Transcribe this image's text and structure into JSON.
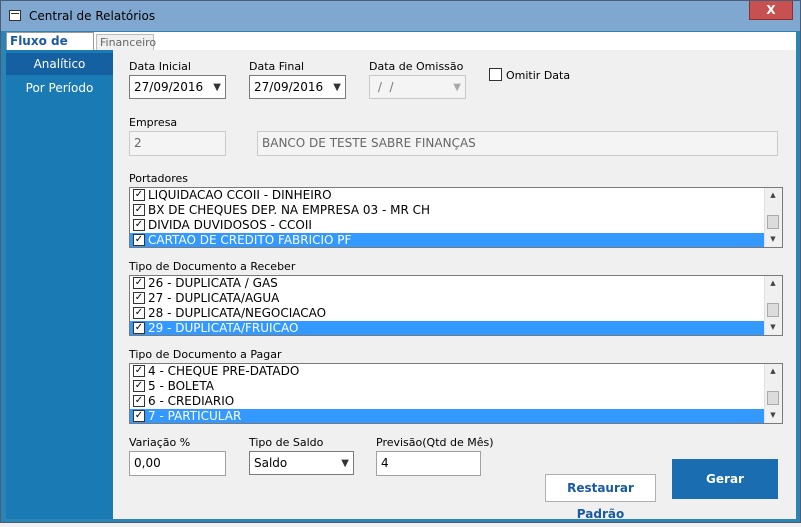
{
  "window": {
    "title": "Central de Relatórios",
    "close_label": "X"
  },
  "tabs": {
    "active": "Fluxo de Caixa",
    "inactive": "Financeiro"
  },
  "sidebar": {
    "items": [
      {
        "label": "Analítico"
      },
      {
        "label": "Por Período"
      }
    ]
  },
  "form": {
    "data_inicial": {
      "label": "Data Inicial",
      "value": "27/09/2016"
    },
    "data_final": {
      "label": "Data Final",
      "value": "27/09/2016"
    },
    "data_omissao": {
      "label": "Data de Omissão",
      "value": " /  /"
    },
    "omitir_data": {
      "label": "Omitir Data",
      "checked": false
    },
    "empresa": {
      "label": "Empresa",
      "code": "2",
      "name": "BANCO DE TESTE SABRE FINANÇAS"
    },
    "portadores": {
      "label": "Portadores",
      "items": [
        {
          "text": "LIQUIDACAO CCOII - DINHEIRO",
          "checked": true,
          "selected": false
        },
        {
          "text": "BX DE CHEQUES DEP. NA EMPRESA 03 - MR CH",
          "checked": true,
          "selected": false
        },
        {
          "text": "DIVIDA DUVIDOSOS - CCOII",
          "checked": true,
          "selected": false
        },
        {
          "text": "CARTAO DE CREDITO FABRICIO PF",
          "checked": true,
          "selected": true
        }
      ]
    },
    "tipo_doc_receber": {
      "label": "Tipo de Documento a Receber",
      "items": [
        {
          "text": "26 - DUPLICATA / GAS",
          "checked": true,
          "selected": false
        },
        {
          "text": "27 - DUPLICATA/AGUA",
          "checked": true,
          "selected": false
        },
        {
          "text": "28 - DUPLICATA/NEGOCIACAO",
          "checked": true,
          "selected": false
        },
        {
          "text": "29 - DUPLICATA/FRUICAO",
          "checked": true,
          "selected": true
        }
      ]
    },
    "tipo_doc_pagar": {
      "label": "Tipo de Documento a Pagar",
      "items": [
        {
          "text": "4 - CHEQUE PRE-DATADO",
          "checked": true,
          "selected": false
        },
        {
          "text": "5 - BOLETA",
          "checked": true,
          "selected": false
        },
        {
          "text": "6 - CREDIARIO",
          "checked": true,
          "selected": false
        },
        {
          "text": "7 - PARTICULAR",
          "checked": true,
          "selected": true
        }
      ]
    },
    "variacao": {
      "label": "Variação %",
      "value": "0,00"
    },
    "tipo_saldo": {
      "label": "Tipo de Saldo",
      "value": "Saldo"
    },
    "previsao": {
      "label": "Previsão(Qtd de Mês)",
      "value": "4"
    }
  },
  "buttons": {
    "restaurar": "Restaurar Padrão",
    "gerar": "Gerar"
  },
  "colors": {
    "accent": "#1a7ab4",
    "selection": "#3399ff",
    "button": "#1a6db0"
  }
}
